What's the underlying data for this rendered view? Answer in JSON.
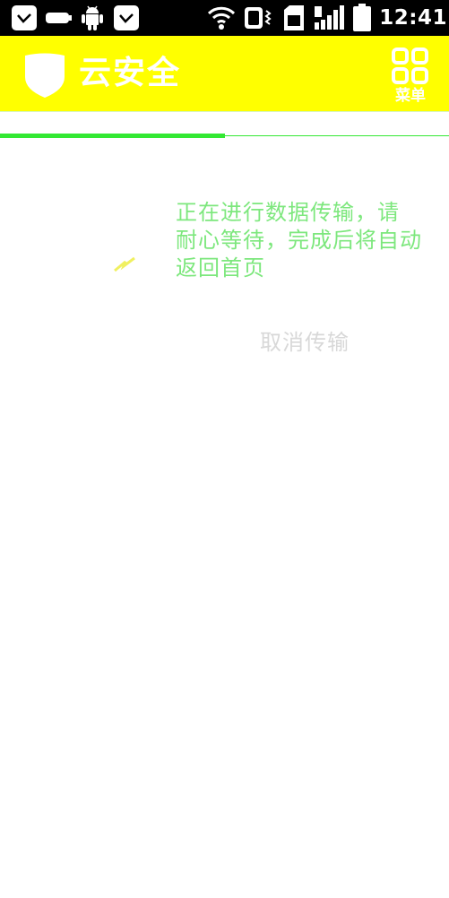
{
  "status_bar": {
    "time": "12:41",
    "left_icons": [
      "notification-icon",
      "battery-pill-icon",
      "android-icon",
      "notification-icon"
    ],
    "right_icons": [
      "wifi-icon",
      "vibrate-icon",
      "sim-icon",
      "signal-icon",
      "battery-icon"
    ]
  },
  "app_bar": {
    "title": "云安全",
    "menu_label": "菜单",
    "background": "#ffff00"
  },
  "progress": {
    "value": 0.5,
    "color": "#33e833"
  },
  "content": {
    "message_lines": [
      "正在进行数据传输，请",
      "耐心等待，完成后将自动",
      "返回首页"
    ],
    "action_label": "取消传输"
  }
}
